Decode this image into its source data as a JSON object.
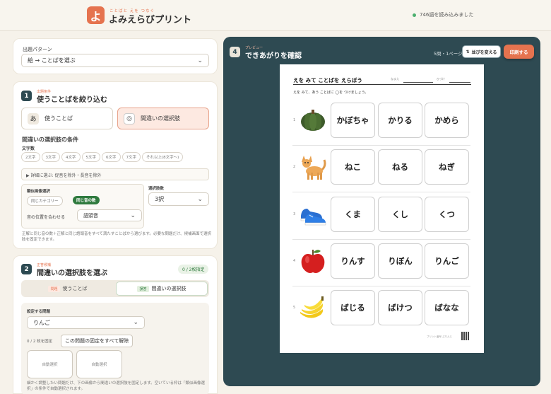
{
  "header": {
    "logo_char": "よ",
    "logo_ruby": "ことばと えを つなぐ",
    "title": "よみえらびプリント",
    "status": "746語を読み込みました"
  },
  "pattern_card": {
    "label": "出題パターン",
    "value": "絵 → ことばを選ぶ"
  },
  "step1": {
    "num": "1",
    "ruby": "出題条件",
    "title": "使うことばを絞り込む",
    "toggle_words": "使うことば",
    "toggle_words_icon": "あ",
    "toggle_distractors": "間違いの選択肢",
    "cond_title": "間違いの選択肢の条件",
    "char_count_label": "文字数",
    "char_chips": [
      "2文字",
      "3文字",
      "4文字",
      "5文字",
      "6文字",
      "7文字",
      "それ以上(8文字〜)"
    ],
    "details": "▶  詳細に選ぶ: 促音を除外・長音を除外",
    "similar_label": "類似画像選択",
    "similar_opt1": "同じカテゴリー",
    "similar_opt2": "同じ音の数",
    "position_label": "音の位置を合わせる",
    "position_value": "語頭音",
    "choice_count_label": "選択肢数",
    "choice_count_value": "3択",
    "note": "正解と同じ音の数＋正解と同じ語頭音をすべて満たすことばから選びます。必要な問題だけ、候補画面で選択肢を固定できます。"
  },
  "step2": {
    "num": "2",
    "ruby": "正答候補",
    "title": "間違いの選択肢を選ぶ",
    "badge": "0 / 2枚指定",
    "tab1_tag": "問題",
    "tab1": "使うことば",
    "tab2_tag": "誤答",
    "tab2": "間違いの選択肢",
    "target_label": "設定する問題",
    "target_value": "りんご",
    "fixed_count": "0 / 2 枚を固定",
    "clear_button": "この問題の固定をすべて解除",
    "slot1": "自動選択",
    "slot2": "自動選択",
    "note": "細かく調整したい問題だけ、下の画像から間違いの選択肢を固定します。空いている枠は「類似画像選択」の条件で自動選択されます。"
  },
  "preview": {
    "num": "4",
    "ruby": "プレビュー",
    "title": "できあがりを確認",
    "page_info": "5問・1ページ",
    "shuffle_button": "並びを変える",
    "print_button": "印刷する"
  },
  "worksheet": {
    "title": "えを みて ことばを えらぼう",
    "date_label": "なまえ",
    "name_label": "ひづけ",
    "instruction": "えを みて、あう ことばに ◯を つけましょう。",
    "footer": "プリント番号 ぷりんと",
    "questions": [
      {
        "n": "1",
        "image": "pumpkin-icon",
        "choices": [
          "かぼちゃ",
          "かりる",
          "かめら"
        ]
      },
      {
        "n": "2",
        "image": "cat-icon",
        "choices": [
          "ねこ",
          "ねる",
          "ねぎ"
        ]
      },
      {
        "n": "3",
        "image": "shoes-icon",
        "choices": [
          "くま",
          "くし",
          "くつ"
        ]
      },
      {
        "n": "4",
        "image": "apple-icon",
        "choices": [
          "りんす",
          "りぼん",
          "りんご"
        ]
      },
      {
        "n": "5",
        "image": "banana-icon",
        "choices": [
          "ばじる",
          "ばけつ",
          "ばなな"
        ]
      }
    ]
  },
  "colors": {
    "accent": "#e5734f",
    "dark": "#2e4a52",
    "selected_bg": "#fde9e1",
    "green": "#2f7a3e"
  }
}
